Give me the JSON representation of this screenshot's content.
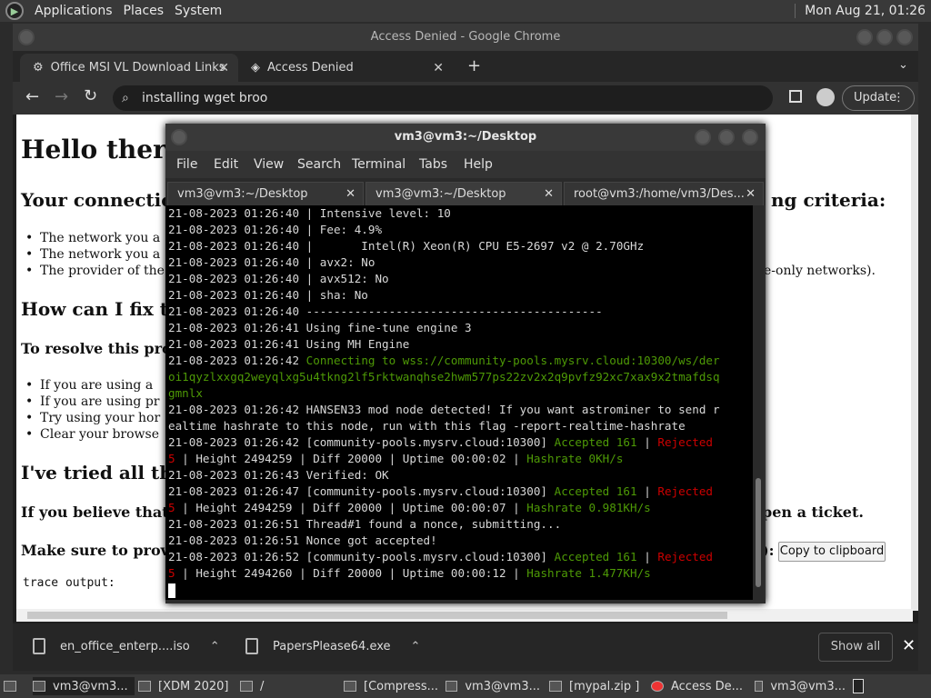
{
  "top_panel": {
    "menus": [
      "Applications",
      "Places",
      "System"
    ],
    "clock": "Mon Aug 21, 01:26"
  },
  "chrome": {
    "title": "Access Denied - Google Chrome",
    "tabs": [
      {
        "label": "Office MSI VL Download Links"
      },
      {
        "label": "Access Denied"
      }
    ],
    "omnibox_text": "installing wget broo",
    "update_label": "Update",
    "page": {
      "h1": "Hello there!",
      "h2_connection": "Your connection",
      "h2_connection_tail": "ng criteria:",
      "bullets1": [
        "The network you a",
        "The network you a",
        "The provider of the"
      ],
      "bullet3_tail": "e-only networks).",
      "h2_fix": "How can I fix th",
      "h3_resolve": "To resolve this probl",
      "bullets2": [
        "If you are using a",
        "If you are using pr",
        "Try using your hor",
        "Clear your browse"
      ],
      "h2_tried": "I've tried all tha",
      "h3_believe": "If you believe that y",
      "h3_believe_tail": "pen a ticket.",
      "h3_provide": "Make sure to provid",
      "h3_provide_tail": "):",
      "copy_button": "Copy to clipboard",
      "trace_label": "trace output:"
    }
  },
  "downloads": {
    "items": [
      "en_office_enterp....iso",
      "PapersPlease64.exe"
    ],
    "show_all": "Show all"
  },
  "taskbar": {
    "items": [
      "vm3@vm3...",
      "[XDM 2020]",
      "/",
      "[Compress...",
      "vm3@vm3...",
      "[mypal.zip ]",
      "Access De...",
      "vm3@vm3..."
    ]
  },
  "terminal": {
    "title": "vm3@vm3:~/Desktop",
    "menu": [
      "File",
      "Edit",
      "View",
      "Search",
      "Terminal",
      "Tabs",
      "Help"
    ],
    "tabs": [
      "vm3@vm3:~/Desktop",
      "vm3@vm3:~/Desktop",
      "root@vm3:/home/vm3/Des..."
    ],
    "lines": [
      {
        "segs": [
          {
            "t": "21-08-2023 01:26:40 | Intensive level: 10",
            "c": ""
          }
        ]
      },
      {
        "segs": [
          {
            "t": "21-08-2023 01:26:40 | Fee: 4.9%",
            "c": ""
          }
        ]
      },
      {
        "segs": [
          {
            "t": "21-08-2023 01:26:40 |       Intel(R) Xeon(R) CPU E5-2697 v2 @ 2.70GHz",
            "c": ""
          }
        ]
      },
      {
        "segs": [
          {
            "t": "21-08-2023 01:26:40 | avx2: No",
            "c": ""
          }
        ]
      },
      {
        "segs": [
          {
            "t": "21-08-2023 01:26:40 | avx512: No",
            "c": ""
          }
        ]
      },
      {
        "segs": [
          {
            "t": "21-08-2023 01:26:40 | sha: No",
            "c": ""
          }
        ]
      },
      {
        "segs": [
          {
            "t": "21-08-2023 01:26:40 -------------------------------------------",
            "c": ""
          }
        ]
      },
      {
        "segs": [
          {
            "t": "21-08-2023 01:26:41 Using fine-tune engine 3",
            "c": ""
          }
        ]
      },
      {
        "segs": [
          {
            "t": "21-08-2023 01:26:41 Using MH Engine",
            "c": ""
          }
        ]
      },
      {
        "segs": [
          {
            "t": "21-08-2023 01:26:42 ",
            "c": ""
          },
          {
            "t": "Connecting to wss://community-pools.mysrv.cloud:10300/ws/der",
            "c": "g"
          }
        ]
      },
      {
        "segs": [
          {
            "t": "oi1qyzlxxgq2weyqlxg5u4tkng2lf5rktwanqhse2hwm577ps22zv2x2q9pvfz92xc7xax9x2tmafdsq",
            "c": "g"
          }
        ]
      },
      {
        "segs": [
          {
            "t": "gmnlx",
            "c": "g"
          }
        ]
      },
      {
        "segs": [
          {
            "t": "21-08-2023 01:26:42 HANSEN33 mod node detected! If you want astrominer to send r",
            "c": ""
          }
        ]
      },
      {
        "segs": [
          {
            "t": "ealtime hashrate to this node, run with this flag -report-realtime-hashrate",
            "c": ""
          }
        ]
      },
      {
        "segs": [
          {
            "t": "21-08-2023 01:26:42 [community-pools.mysrv.cloud:10300] ",
            "c": ""
          },
          {
            "t": "Accepted 161",
            "c": "g"
          },
          {
            "t": " | ",
            "c": ""
          },
          {
            "t": "Rejected",
            "c": "r"
          }
        ]
      },
      {
        "segs": [
          {
            "t": "5",
            "c": "r"
          },
          {
            "t": " | Height 2494259 | Diff 20000 | Uptime 00:00:02 | ",
            "c": ""
          },
          {
            "t": "Hashrate 0KH/s",
            "c": "g"
          }
        ]
      },
      {
        "segs": [
          {
            "t": "21-08-2023 01:26:43 Verified: OK",
            "c": ""
          }
        ]
      },
      {
        "segs": [
          {
            "t": "21-08-2023 01:26:47 [community-pools.mysrv.cloud:10300] ",
            "c": ""
          },
          {
            "t": "Accepted 161",
            "c": "g"
          },
          {
            "t": " | ",
            "c": ""
          },
          {
            "t": "Rejected",
            "c": "r"
          }
        ]
      },
      {
        "segs": [
          {
            "t": "5",
            "c": "r"
          },
          {
            "t": " | Height 2494259 | Diff 20000 | Uptime 00:00:07 | ",
            "c": ""
          },
          {
            "t": "Hashrate 0.981KH/s",
            "c": "g"
          }
        ]
      },
      {
        "segs": [
          {
            "t": "21-08-2023 01:26:51 Thread#1 found a nonce, submitting...",
            "c": ""
          }
        ]
      },
      {
        "segs": [
          {
            "t": "21-08-2023 01:26:51 Nonce got accepted!",
            "c": ""
          }
        ]
      },
      {
        "segs": [
          {
            "t": "21-08-2023 01:26:52 [community-pools.mysrv.cloud:10300] ",
            "c": ""
          },
          {
            "t": "Accepted 161",
            "c": "g"
          },
          {
            "t": " | ",
            "c": ""
          },
          {
            "t": "Rejected",
            "c": "r"
          }
        ]
      },
      {
        "segs": [
          {
            "t": "5",
            "c": "r"
          },
          {
            "t": " | Height 2494260 | Diff 20000 | Uptime 00:00:12 | ",
            "c": ""
          },
          {
            "t": "Hashrate 1.477KH/s",
            "c": "g"
          }
        ]
      }
    ]
  }
}
